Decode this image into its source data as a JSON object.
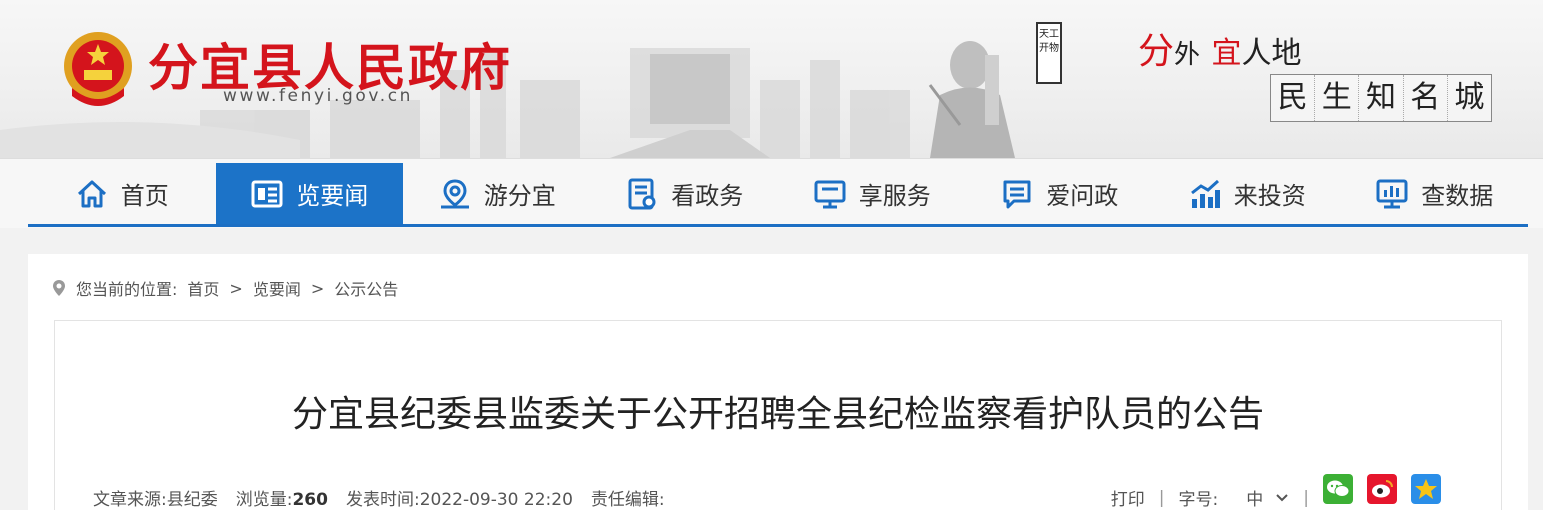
{
  "header": {
    "site_title": "分宜县人民政府",
    "site_url": "www.fenyi.gov.cn",
    "seal_text": "天工开物",
    "slogan_line1": [
      "分",
      "外",
      "宜",
      "人",
      "地"
    ],
    "slogan_line2": [
      "民",
      "生",
      "知",
      "名",
      "城"
    ]
  },
  "nav": {
    "items": [
      {
        "label": "首页",
        "icon": "home-icon"
      },
      {
        "label": "览要闻",
        "icon": "news-icon",
        "active": true
      },
      {
        "label": "游分宜",
        "icon": "location-icon"
      },
      {
        "label": "看政务",
        "icon": "document-icon"
      },
      {
        "label": "享服务",
        "icon": "monitor-icon"
      },
      {
        "label": "爱问政",
        "icon": "chat-icon"
      },
      {
        "label": "来投资",
        "icon": "chart-icon"
      },
      {
        "label": "查数据",
        "icon": "data-icon"
      }
    ]
  },
  "breadcrumb": {
    "prefix": "您当前的位置:",
    "items": [
      "首页",
      "览要闻",
      "公示公告"
    ],
    "separator": ">"
  },
  "article": {
    "title": "分宜县纪委县监委关于公开招聘全县纪检监察看护队员的公告",
    "source_label": "文章来源:",
    "source_value": "县纪委",
    "views_label": "浏览量:",
    "views_value": "260",
    "time_label": "发表时间:",
    "time_value": "2022-09-30 22:20",
    "editor_label": "责任编辑:",
    "editor_value": ""
  },
  "tools": {
    "print_label": "打印",
    "divider": "|",
    "font_label": "字号:",
    "font_value": "中"
  },
  "colors": {
    "brand_red": "#d4141c",
    "nav_blue": "#1c73c8"
  }
}
